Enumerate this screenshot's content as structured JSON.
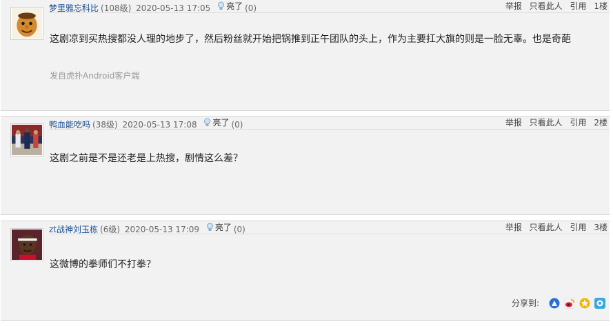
{
  "posts": [
    {
      "username": "梦里雅忘科比",
      "level": "(108级)",
      "time": "2020-05-13 17:05",
      "light_label": "亮了",
      "light_count": "(0)",
      "ops": {
        "report": "举报",
        "only_this": "只看此人",
        "quote": "引用",
        "floor": "1楼"
      },
      "content": "这剧凉到买热搜都没人理的地步了，然后粉丝就开始把锅推到正午团队的头上，作为主要扛大旗的则是一脸无辜。也是奇葩",
      "device": "发自虎扑Android客户端"
    },
    {
      "username": "鸭血能吃吗",
      "level": "(38级)",
      "time": "2020-05-13 17:08",
      "light_label": "亮了",
      "light_count": "(0)",
      "ops": {
        "report": "举报",
        "only_this": "只看此人",
        "quote": "引用",
        "floor": "2楼"
      },
      "content": "这剧之前是不是还老是上热搜，剧情这么差？"
    },
    {
      "username": "zt战神刘玉栋",
      "level": "(6级)",
      "time": "2020-05-13 17:09",
      "light_label": "亮了",
      "light_count": "(0)",
      "ops": {
        "report": "举报",
        "only_this": "只看此人",
        "quote": "引用",
        "floor": "3楼"
      },
      "content": "这微博的拳师们不打拳？"
    }
  ],
  "share": {
    "label": "分享到:",
    "icons": [
      "tieba-share-icon",
      "weibo-share-icon",
      "qzone-share-icon",
      "qq-share-icon"
    ]
  },
  "colors": {
    "username": "#1a4f90",
    "post_bg": "#f2f2f2",
    "muted": "#999999"
  }
}
